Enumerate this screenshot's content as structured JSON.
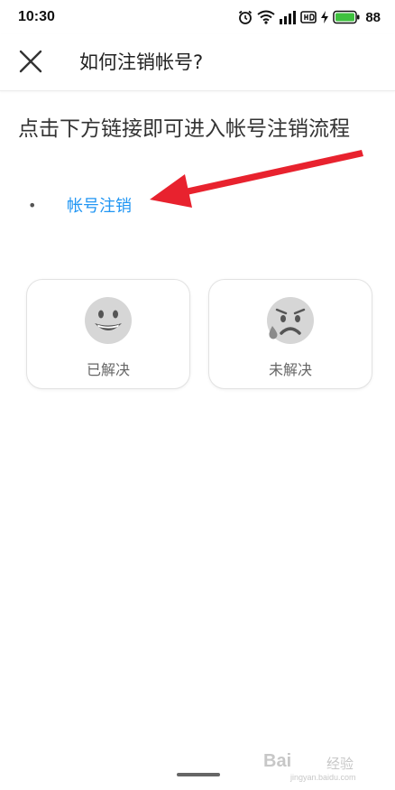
{
  "status_bar": {
    "time": "10:30",
    "battery": "88",
    "icons": [
      "alarm-icon",
      "wifi-icon",
      "signal-icon",
      "hd-icon",
      "charging-icon",
      "battery-icon"
    ]
  },
  "header": {
    "close_icon": "close-icon",
    "title": "如何注销帐号?"
  },
  "content": {
    "heading": "点击下方链接即可进入帐号注销流程",
    "bullet": "•",
    "link_text": "帐号注销"
  },
  "feedback": {
    "resolved_label": "已解决",
    "resolved_icon": "smile-face-icon",
    "unresolved_label": "未解决",
    "unresolved_icon": "sad-face-icon"
  },
  "watermark": {
    "logo": "Bai",
    "name": "经验",
    "url": "jingyan.baidu.com"
  },
  "colors": {
    "link": "#2196f3",
    "arrow": "#e8222e",
    "battery": "#3ec13e",
    "face": "#d6d6d6"
  }
}
